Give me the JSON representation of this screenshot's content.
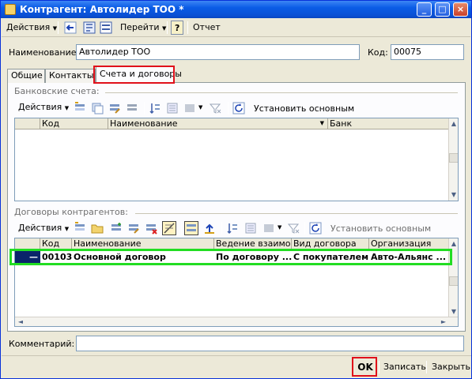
{
  "window": {
    "title": "Контрагент: Автолидер ТОО *",
    "min": "_",
    "max": "□",
    "close": "×"
  },
  "toolbar": {
    "actions": "Действия",
    "goto": "Перейти",
    "report": "Отчет",
    "help": "?"
  },
  "form": {
    "name_label": "Наименование:",
    "name_value": "Автолидер ТОО",
    "code_label": "Код:",
    "code_value": "00075",
    "comment_label": "Комментарий:",
    "comment_value": ""
  },
  "tabs": [
    "Общие",
    "Контакты",
    "Счета и договоры"
  ],
  "bank": {
    "title": "Банковские счета:",
    "actions": "Действия",
    "set_main": "Установить основным",
    "columns": [
      "Код",
      "Наименование",
      "Банк"
    ]
  },
  "contracts": {
    "title": "Договоры контрагентов:",
    "actions": "Действия",
    "set_main": "Установить основным",
    "columns": [
      "Код",
      "Наименование",
      "Ведение взаимо...",
      "Вид договора",
      "Организация"
    ],
    "rows": [
      {
        "marker": "—",
        "code": "00103",
        "name": "Основной договор",
        "mode": "По договору ...",
        "kind": "С покупателем",
        "org": "Авто-Альянс ..."
      }
    ]
  },
  "buttons": {
    "ok": "OK",
    "save": "Записать",
    "close": "Закрыть"
  },
  "colors": {
    "title_bar": "#0a5ce6",
    "highlight_red": "#e0101a",
    "highlight_green": "#22dd22",
    "selected_row": "#0a246a"
  }
}
